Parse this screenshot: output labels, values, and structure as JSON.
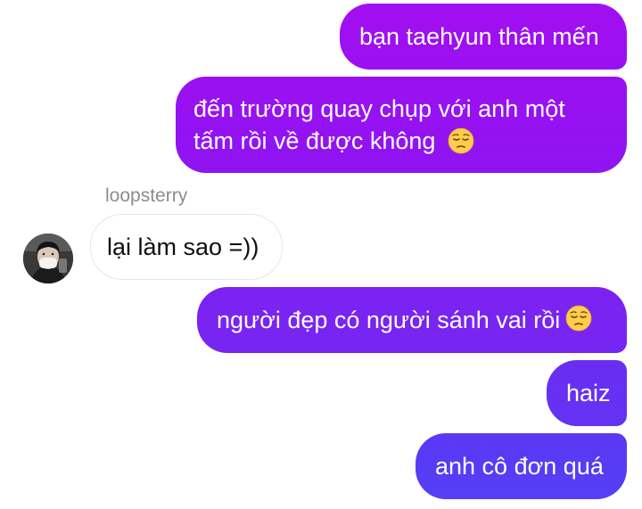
{
  "conversation": {
    "messages": [
      {
        "direction": "outgoing",
        "text": "bạn taehyun thân mến"
      },
      {
        "direction": "outgoing",
        "lines": [
          "đến trường quay chụp với anh một",
          "tấm rồi về được không"
        ],
        "emoji": "pensive-face"
      },
      {
        "direction": "incoming",
        "sender": "loopsterry",
        "text": "lại làm sao =))"
      },
      {
        "direction": "outgoing",
        "text": "người đẹp có người sánh vai rồi",
        "emoji": "pensive-face"
      },
      {
        "direction": "outgoing",
        "text": "haiz"
      },
      {
        "direction": "outgoing",
        "text": "anh cô đơn quá"
      }
    ]
  },
  "colors": {
    "outgoing_start": "#a20ff0",
    "outgoing_end": "#553ff5",
    "incoming_bg": "#ffffff",
    "incoming_border": "#e4e6eb",
    "sender_name": "#8a8d91"
  },
  "icons": {
    "avatar": "user-avatar-photo",
    "emoji": "pensive-face"
  }
}
